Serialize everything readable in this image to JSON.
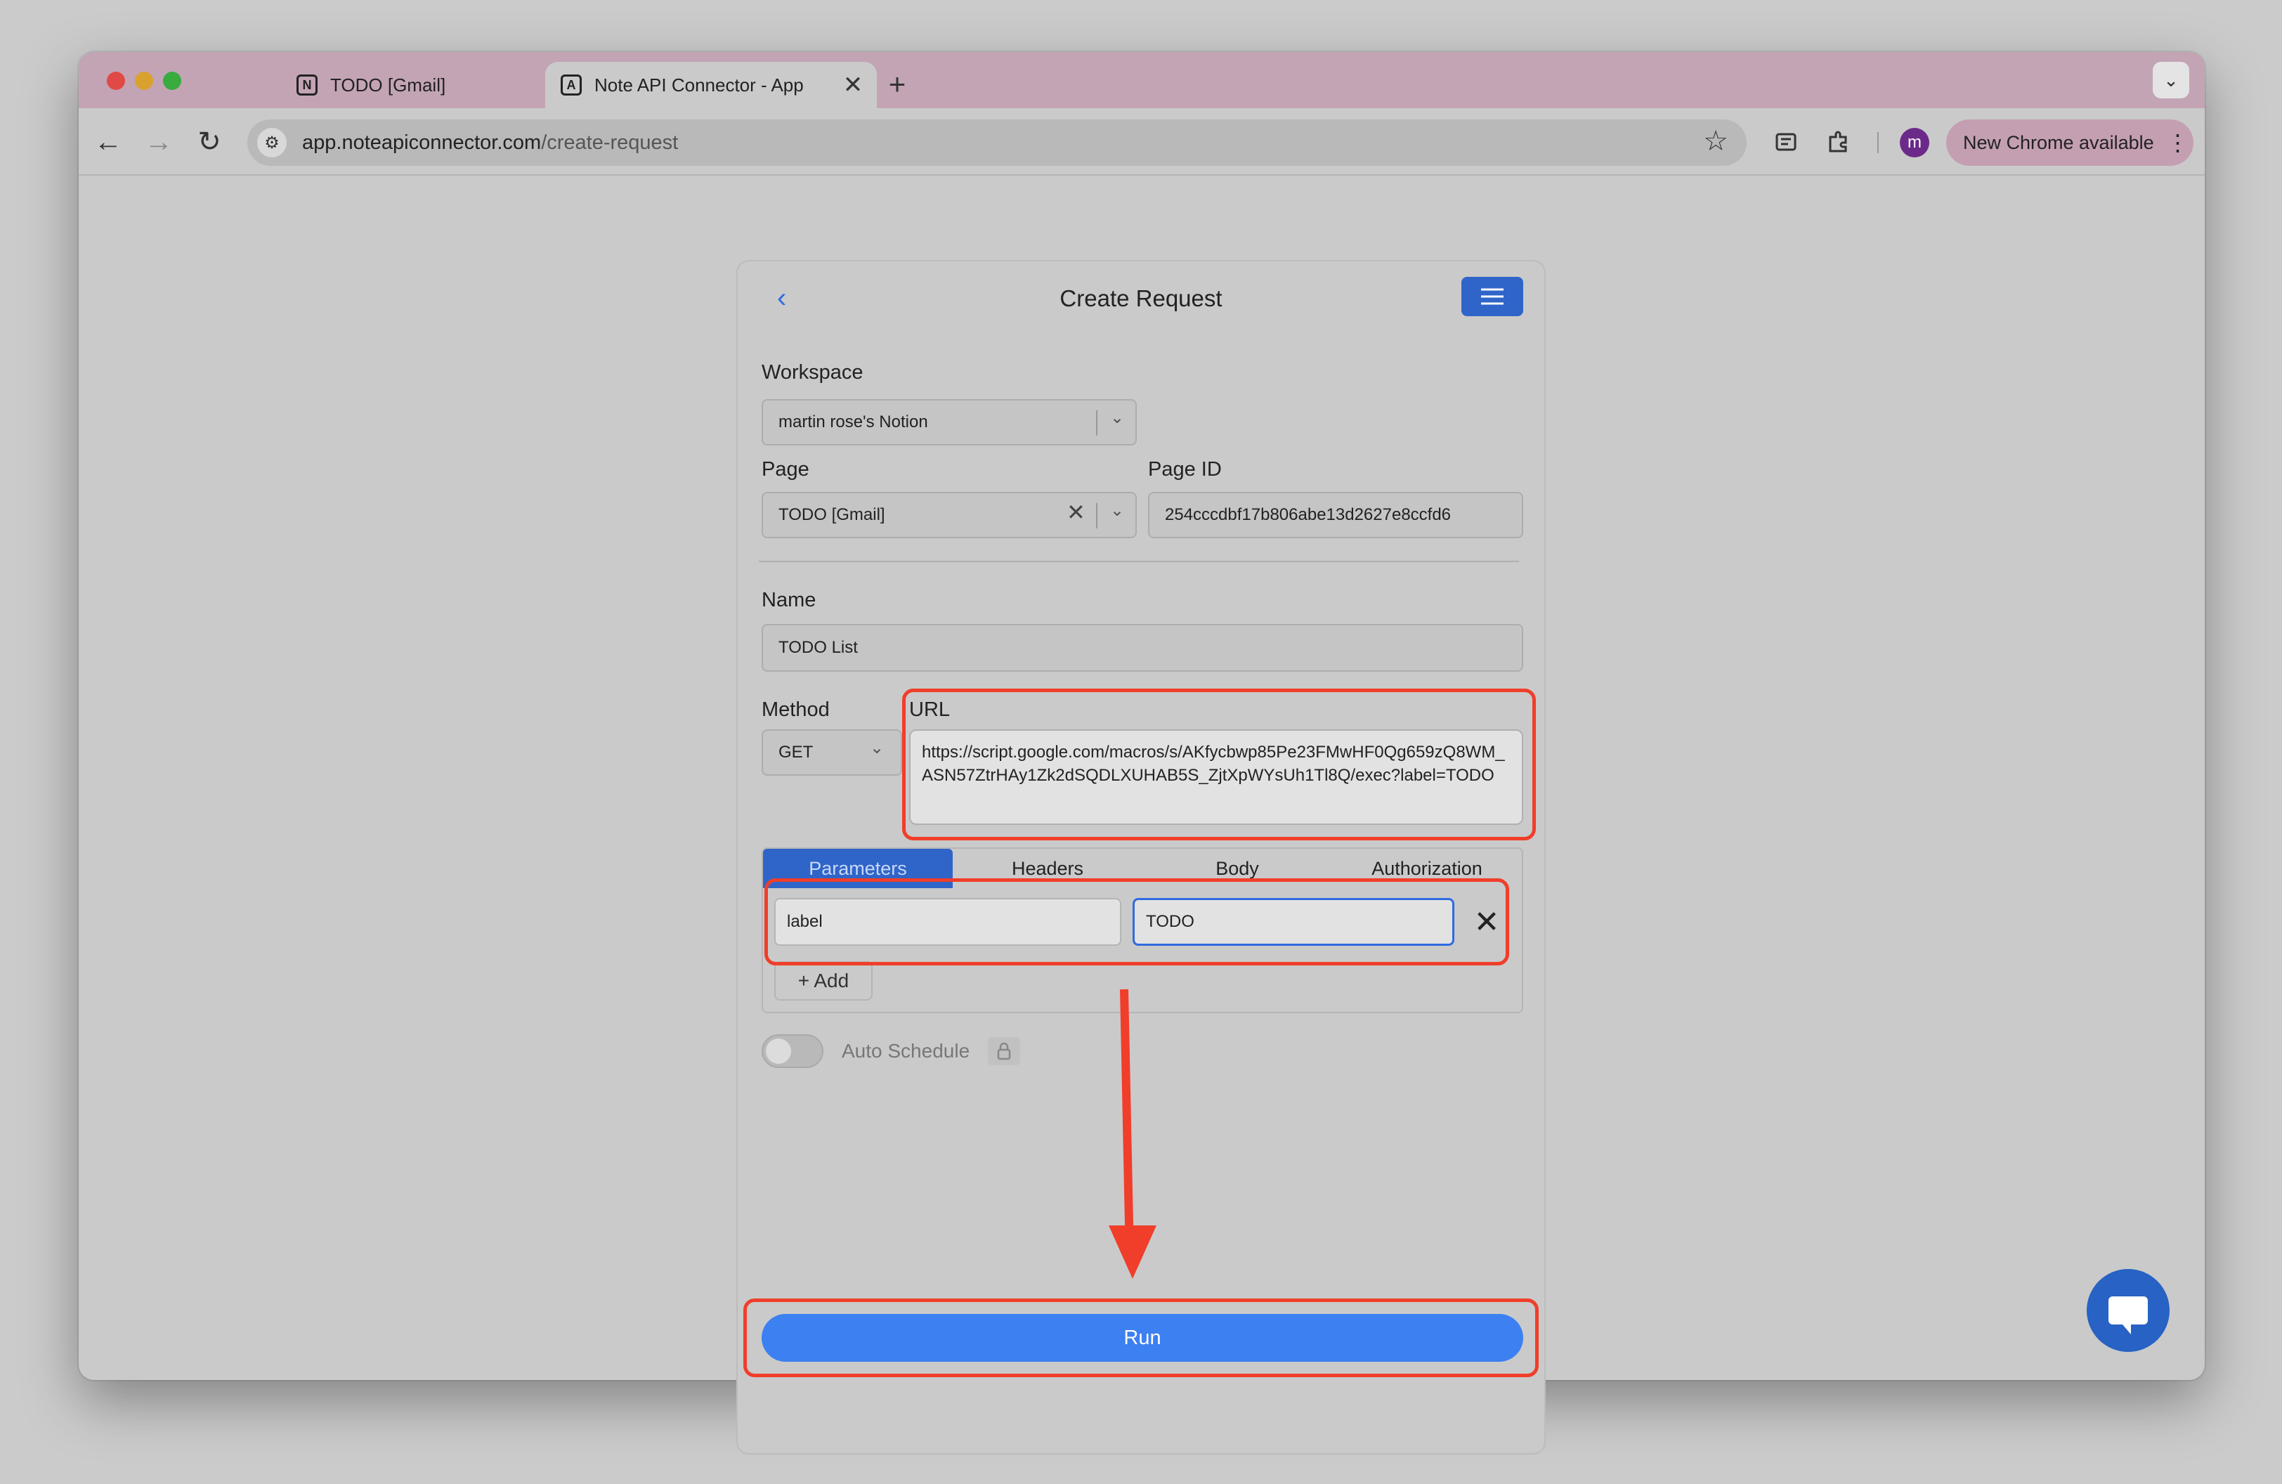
{
  "browser": {
    "tabs": [
      {
        "title": "TODO [Gmail]",
        "favicon": "N",
        "icon": "notion-icon"
      },
      {
        "title": "Note API Connector - App",
        "favicon": "A",
        "icon": "app-icon"
      }
    ],
    "close_glyph": "✕",
    "new_tab_glyph": "+",
    "tab_menu_glyph": "⌄",
    "url_host": "app.noteapiconnector.com",
    "url_path": "/create-request",
    "avatar_letter": "m",
    "update_label": "New Chrome available",
    "kebab_glyph": "⋮",
    "back_glyph": "←",
    "forward_glyph": "→",
    "reload_glyph": "↻",
    "star_glyph": "☆",
    "site_info_glyph": "⚙"
  },
  "page": {
    "title": "Create Request",
    "back_glyph": "‹",
    "workspace": {
      "label": "Workspace",
      "value": "martin rose's Notion"
    },
    "page_field": {
      "label": "Page",
      "value": "TODO [Gmail]"
    },
    "page_id": {
      "label": "Page ID",
      "value": "254cccdbf17b806abe13d2627e8ccfd6"
    },
    "name": {
      "label": "Name",
      "value": "TODO List"
    },
    "method": {
      "label": "Method",
      "value": "GET"
    },
    "url": {
      "label": "URL",
      "value": "https://script.google.com/macros/s/AKfycbwp85Pe23FMwHF0Qg659zQ8WM_ASN57ZtrHAy1Zk2dSQDLXUHAB5S_ZjtXpWYsUh1Tl8Q/exec?label=TODO"
    },
    "request_tabs": [
      "Parameters",
      "Headers",
      "Body",
      "Authorization"
    ],
    "params": [
      {
        "key": "label",
        "value": "TODO"
      }
    ],
    "add_label": "+ Add",
    "auto_schedule_label": "Auto Schedule",
    "run_label": "Run",
    "dropdown_glyph": "⌄",
    "clear_glyph": "✕",
    "delete_glyph": "✕",
    "lock_glyph": "🔒"
  },
  "colors": {
    "accent": "#3c80f1",
    "annotation": "#f03e2a",
    "menu_button": "#2f65c8"
  }
}
